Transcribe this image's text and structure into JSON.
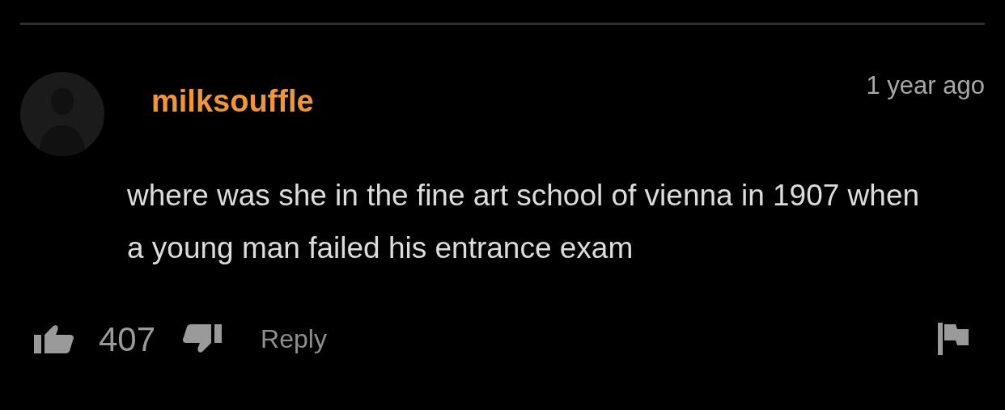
{
  "comment": {
    "username": "milksouffle",
    "time": "1 year ago",
    "text": "where was she in the fine art school of vienna in 1907 when a young man failed his entrance exam"
  },
  "actions": {
    "likes": "407",
    "reply": "Reply"
  }
}
